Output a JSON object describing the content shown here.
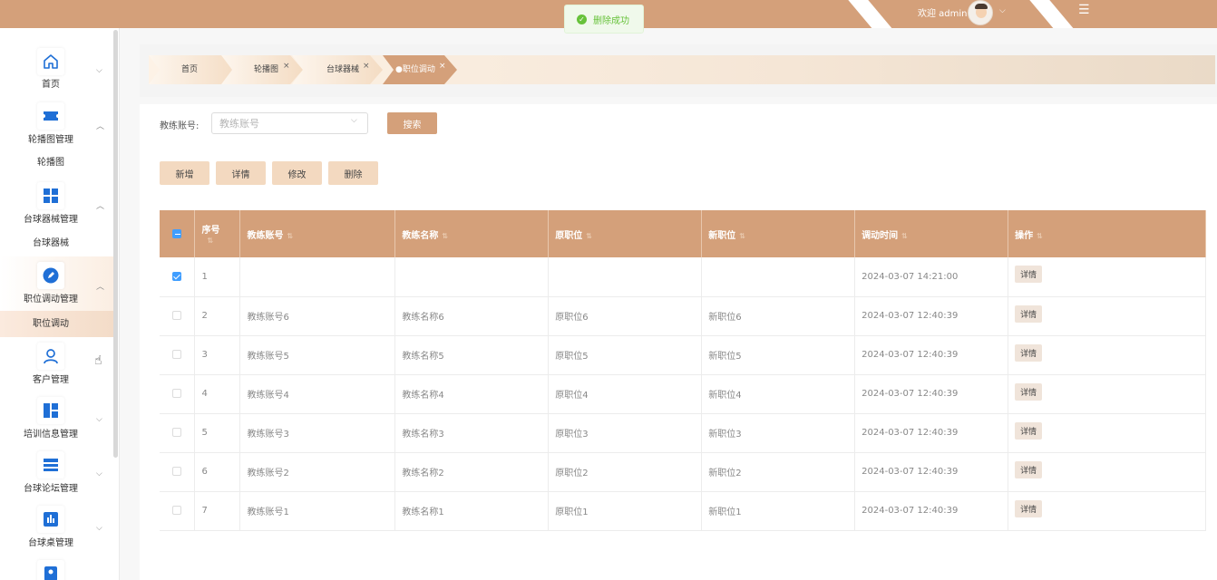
{
  "header": {
    "welcome": "欢迎 admin",
    "chevron_icon": "chevron-down-icon",
    "menu_icon": "hamburger-icon"
  },
  "toast": {
    "message": "删除成功"
  },
  "sidebar": {
    "items": [
      {
        "label": "首页",
        "icon": "home-icon"
      },
      {
        "label": "轮播图管理",
        "icon": "ticket-icon"
      },
      {
        "label": "台球器械管理",
        "icon": "grid-icon"
      },
      {
        "label": "职位调动管理",
        "icon": "edit-circle-icon"
      },
      {
        "label": "客户管理",
        "icon": "user-icon"
      },
      {
        "label": "培训信息管理",
        "icon": "layout-icon"
      },
      {
        "label": "台球论坛管理",
        "icon": "list-icon"
      },
      {
        "label": "台球桌管理",
        "icon": "chart-icon"
      }
    ],
    "subitems": [
      {
        "label": "轮播图"
      },
      {
        "label": "台球器械"
      },
      {
        "label": "职位调动"
      }
    ]
  },
  "breadcrumbs": [
    {
      "label": "首页"
    },
    {
      "label": "轮播图"
    },
    {
      "label": "台球器械"
    },
    {
      "label": "职位调动"
    }
  ],
  "search": {
    "label": "教练账号:",
    "placeholder": "教练账号",
    "button": "搜索"
  },
  "actions": {
    "add": "新增",
    "detail": "详情",
    "edit": "修改",
    "delete": "删除"
  },
  "table": {
    "headers": [
      "序号",
      "教练账号",
      "教练名称",
      "原职位",
      "新职位",
      "调动时间",
      "操作"
    ],
    "detail_label": "详情",
    "rows": [
      {
        "no": "1",
        "account": "",
        "name": "",
        "old": "",
        "new": "",
        "time": "2024-03-07 14:21:00",
        "checked": true
      },
      {
        "no": "2",
        "account": "教练账号6",
        "name": "教练名称6",
        "old": "原职位6",
        "new": "新职位6",
        "time": "2024-03-07 12:40:39",
        "checked": false
      },
      {
        "no": "3",
        "account": "教练账号5",
        "name": "教练名称5",
        "old": "原职位5",
        "new": "新职位5",
        "time": "2024-03-07 12:40:39",
        "checked": false
      },
      {
        "no": "4",
        "account": "教练账号4",
        "name": "教练名称4",
        "old": "原职位4",
        "new": "新职位4",
        "time": "2024-03-07 12:40:39",
        "checked": false
      },
      {
        "no": "5",
        "account": "教练账号3",
        "name": "教练名称3",
        "old": "原职位3",
        "new": "新职位3",
        "time": "2024-03-07 12:40:39",
        "checked": false
      },
      {
        "no": "6",
        "account": "教练账号2",
        "name": "教练名称2",
        "old": "原职位2",
        "new": "新职位2",
        "time": "2024-03-07 12:40:39",
        "checked": false
      },
      {
        "no": "7",
        "account": "教练账号1",
        "name": "教练名称1",
        "old": "原职位1",
        "new": "新职位1",
        "time": "2024-03-07 12:40:39",
        "checked": false
      }
    ]
  },
  "colors": {
    "accent": "#d4a07a",
    "icon_blue": "#1f6fd6",
    "success": "#67c23a",
    "checkbox": "#409eff"
  }
}
